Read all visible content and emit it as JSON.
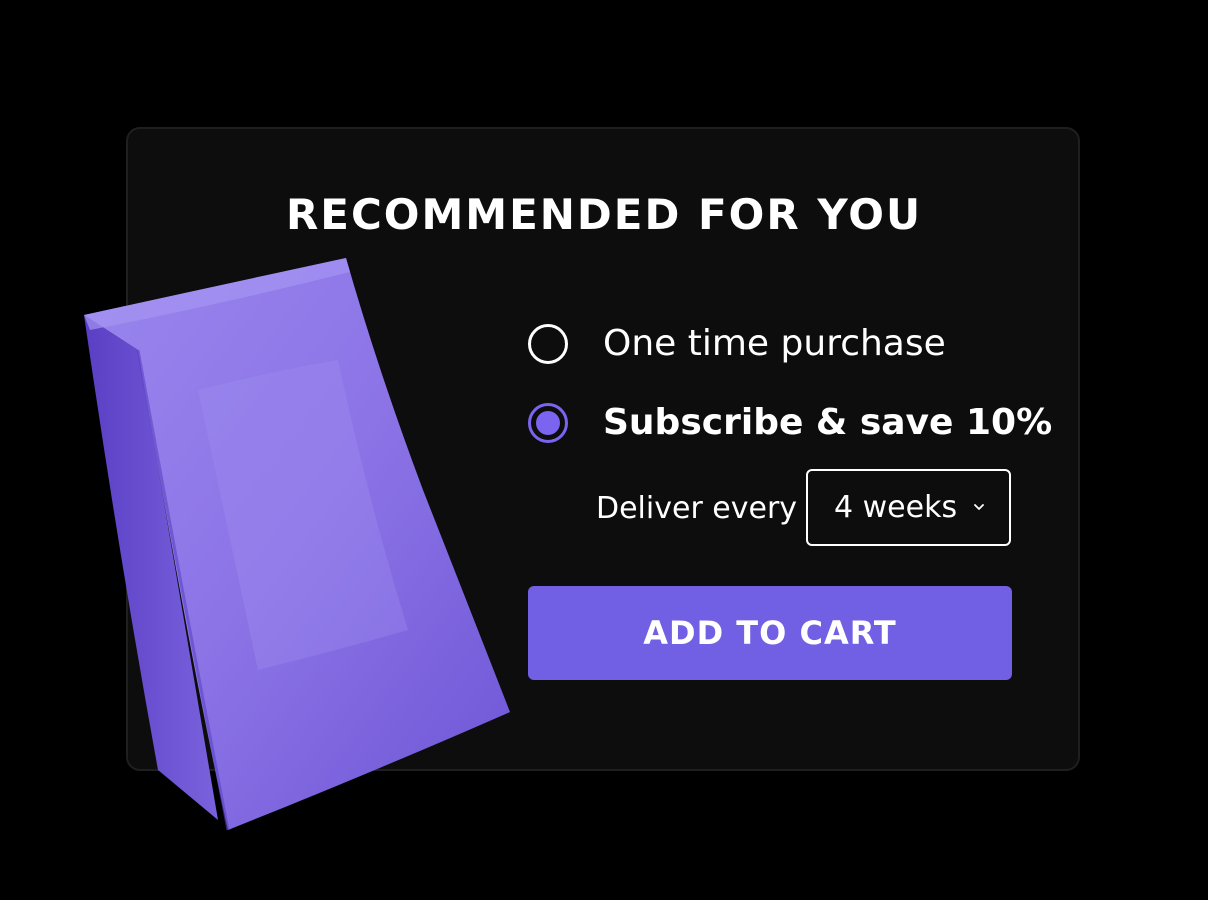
{
  "card": {
    "title": "RECOMMENDED FOR YOU"
  },
  "purchase_options": [
    {
      "label": "One time purchase",
      "selected": false
    },
    {
      "label": "Subscribe & save 10%",
      "selected": true
    }
  ],
  "delivery": {
    "label": "Deliver every",
    "selected_interval": "4 weeks"
  },
  "cta": {
    "label": "ADD TO CART"
  },
  "product": {
    "image": "purple-pouch-bag"
  },
  "colors": {
    "background": "#000000",
    "card": "#0d0d0d",
    "accent": "#7160e4",
    "bag": "#8f78e8"
  }
}
